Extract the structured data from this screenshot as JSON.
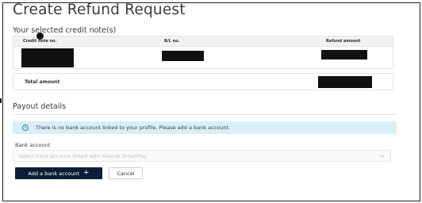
{
  "page": {
    "title": "Create Refund Request"
  },
  "credit_notes": {
    "section_title": "Your selected credit note(s)",
    "columns": [
      "Credit note no.",
      "B/L no.",
      "Refund amount"
    ],
    "rows": [
      {
        "credit_note_no": "",
        "bl_no": "",
        "refund_amount": ""
      }
    ],
    "total_label": "Total amount",
    "total_value": ""
  },
  "payout": {
    "section_title": "Payout details",
    "info_message": "There is no bank account linked to your profile. Please add a bank account.",
    "info_icon": "info-icon",
    "bank_account_label": "Bank account",
    "bank_account_placeholder": "Select bank account linked with Maersk SmartPay",
    "dropdown_icon": "chevron-down-icon"
  },
  "actions": {
    "add_bank_account_label": "Add a bank account",
    "add_icon": "plus-icon",
    "cancel_label": "Cancel"
  },
  "colors": {
    "primary_button": "#0b1e37",
    "info_banner_bg": "#d9eef8",
    "info_icon": "#2f7fb0"
  }
}
